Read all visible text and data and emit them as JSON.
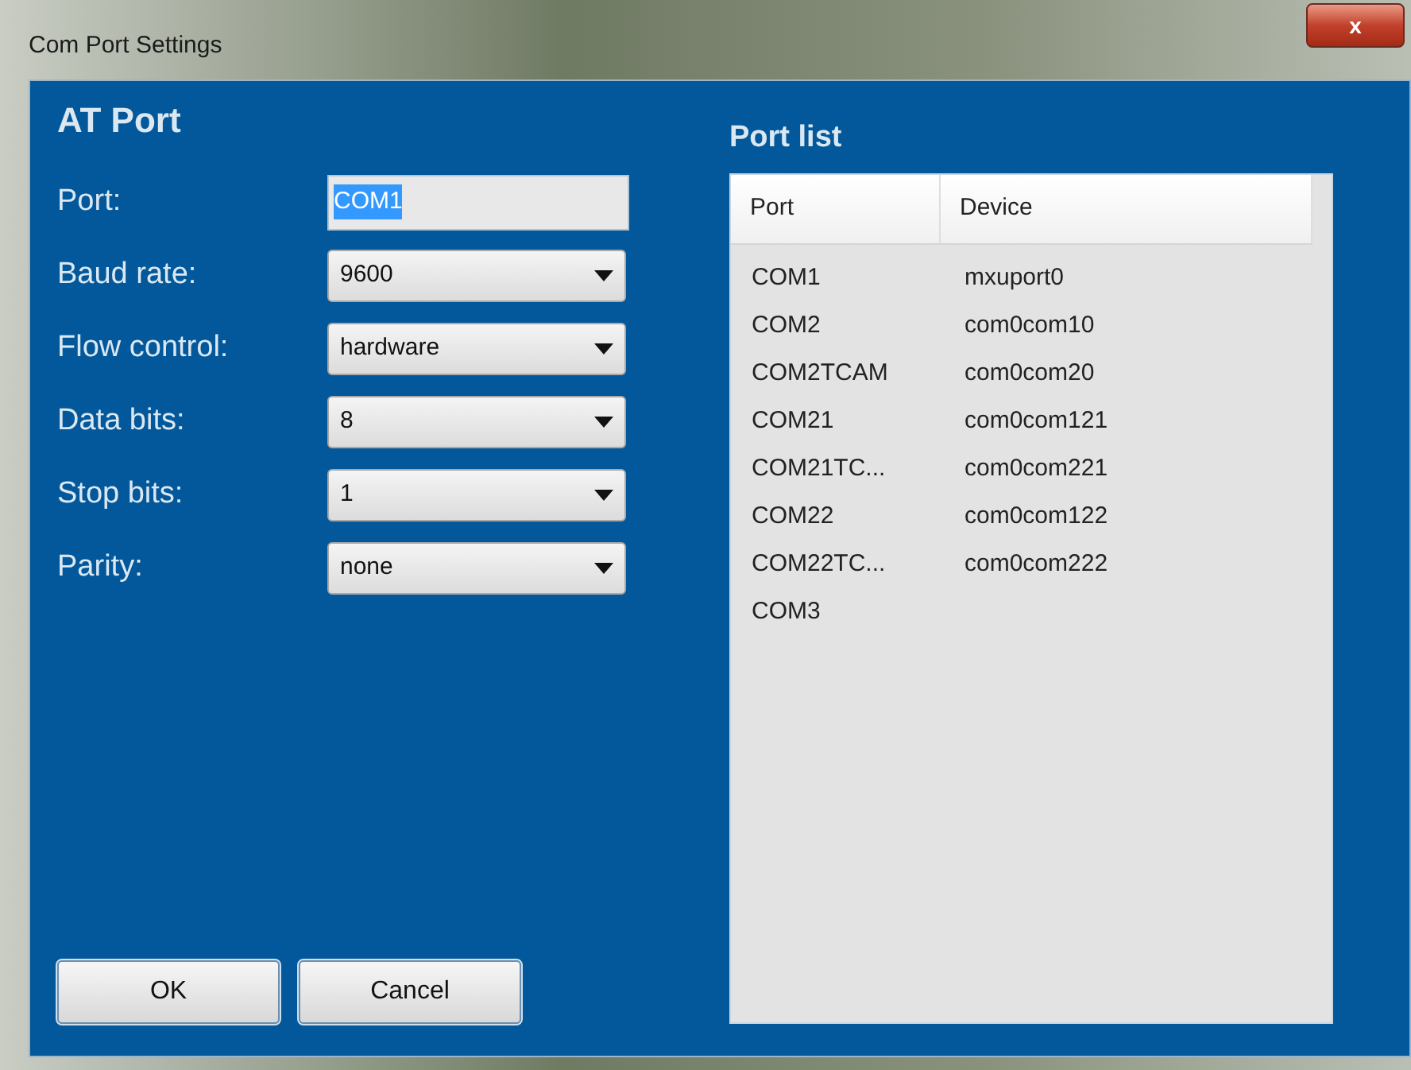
{
  "window": {
    "title": "Com Port Settings",
    "close_label": "x"
  },
  "at_port": {
    "title": "AT Port",
    "fields": [
      {
        "kind": "text",
        "label": "Port:",
        "value": "COM1",
        "text_selected": true
      },
      {
        "kind": "dropdown",
        "label": "Baud rate:",
        "value": "9600"
      },
      {
        "kind": "dropdown",
        "label": "Flow control:",
        "value": "hardware"
      },
      {
        "kind": "dropdown",
        "label": "Data bits:",
        "value": "8"
      },
      {
        "kind": "dropdown",
        "label": "Stop bits:",
        "value": "1"
      },
      {
        "kind": "dropdown",
        "label": "Parity:",
        "value": "none"
      }
    ]
  },
  "buttons": [
    "OK",
    "Cancel"
  ],
  "port_list": {
    "title": "Port list",
    "columns": [
      "Port",
      "Device"
    ],
    "rows": [
      [
        "COM1",
        "mxuport0"
      ],
      [
        "COM2",
        "com0com10"
      ],
      [
        "COM2TCAM",
        "com0com20"
      ],
      [
        "COM21",
        "com0com121"
      ],
      [
        "COM21TC...",
        "com0com221"
      ],
      [
        "COM22",
        "com0com122"
      ],
      [
        "COM22TC...",
        "com0com222"
      ],
      [
        "COM3"
      ]
    ]
  }
}
